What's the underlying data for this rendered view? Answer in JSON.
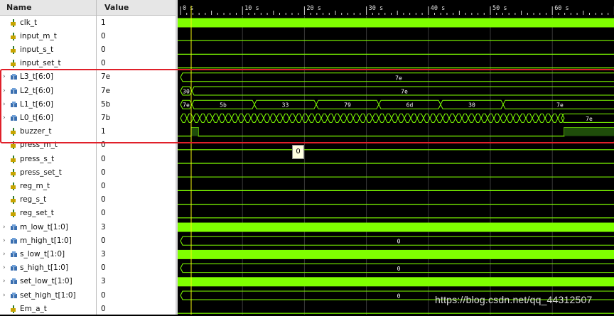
{
  "header": {
    "name_label": "Name",
    "value_label": "Value"
  },
  "timeline": {
    "ticks": [
      "0 s",
      "10 s",
      "20 s",
      "30 s",
      "40 s",
      "50 s",
      "60 s"
    ]
  },
  "cursor_value": "0",
  "watermark": "https://blog.csdn.net/qq_44312507",
  "colors": {
    "wave": "#7fff00",
    "bus_text": "#ffffff",
    "grid": "#2e2e2e",
    "cursor": "#f4f40e",
    "highlight": "#e0202a"
  },
  "signals": [
    {
      "name": "clk_t",
      "value": "1",
      "kind": "bit",
      "expandable": false
    },
    {
      "name": "input_m_t",
      "value": "0",
      "kind": "bit",
      "expandable": false
    },
    {
      "name": "input_s_t",
      "value": "0",
      "kind": "bit",
      "expandable": false
    },
    {
      "name": "input_set_t",
      "value": "0",
      "kind": "bit",
      "expandable": false
    },
    {
      "name": "L3_t[6:0]",
      "value": "7e",
      "kind": "bus",
      "expandable": true
    },
    {
      "name": "L2_t[6:0]",
      "value": "7e",
      "kind": "bus",
      "expandable": true
    },
    {
      "name": "L1_t[6:0]",
      "value": "5b",
      "kind": "bus",
      "expandable": true
    },
    {
      "name": "L0_t[6:0]",
      "value": "7b",
      "kind": "bus",
      "expandable": true
    },
    {
      "name": "buzzer_t",
      "value": "1",
      "kind": "bit",
      "expandable": false
    },
    {
      "name": "press_m_t",
      "value": "0",
      "kind": "bit",
      "expandable": false
    },
    {
      "name": "press_s_t",
      "value": "0",
      "kind": "bit",
      "expandable": false
    },
    {
      "name": "press_set_t",
      "value": "0",
      "kind": "bit",
      "expandable": false
    },
    {
      "name": "reg_m_t",
      "value": "0",
      "kind": "bit",
      "expandable": false
    },
    {
      "name": "reg_s_t",
      "value": "0",
      "kind": "bit",
      "expandable": false
    },
    {
      "name": "reg_set_t",
      "value": "0",
      "kind": "bit",
      "expandable": false
    },
    {
      "name": "m_low_t[1:0]",
      "value": "3",
      "kind": "bus",
      "expandable": true
    },
    {
      "name": "m_high_t[1:0]",
      "value": "0",
      "kind": "bus",
      "expandable": true
    },
    {
      "name": "s_low_t[1:0]",
      "value": "3",
      "kind": "bus",
      "expandable": true
    },
    {
      "name": "s_high_t[1:0]",
      "value": "0",
      "kind": "bus",
      "expandable": true
    },
    {
      "name": "set_low_t[1:0]",
      "value": "3",
      "kind": "bus",
      "expandable": true
    },
    {
      "name": "set_high_t[1:0]",
      "value": "0",
      "kind": "bus",
      "expandable": true
    },
    {
      "name": "Em_a_t",
      "value": "0",
      "kind": "bit",
      "expandable": false
    }
  ],
  "bus_labels": {
    "L3": [
      "7e"
    ],
    "L2": [
      "30",
      "7e"
    ],
    "L1": [
      "7e",
      "5b",
      "33",
      "79",
      "6d",
      "30",
      "7e"
    ],
    "L0": [
      "7e"
    ],
    "m_high": [
      "0"
    ],
    "s_high": [
      "0"
    ],
    "set_high": [
      "0"
    ]
  }
}
